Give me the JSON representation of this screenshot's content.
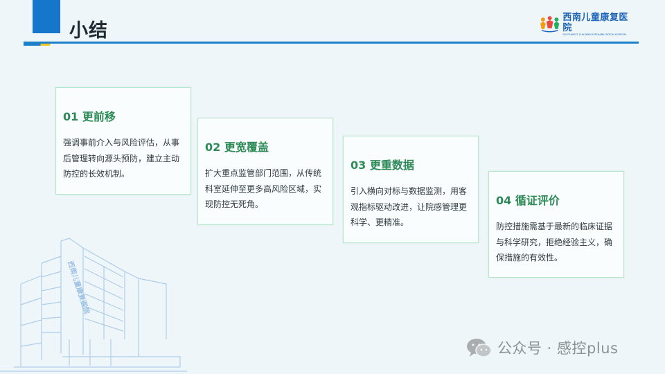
{
  "page": {
    "title": "小结"
  },
  "logo": {
    "name": "西南儿童康复医院",
    "subtitle": "SOUTHWEST CHILDREN'S REHABILITATION HOSPITAL"
  },
  "cards": [
    {
      "heading": "01 更前移",
      "body": "强调事前介入与风险评估，从事后管理转向源头预防，建立主动防控的长效机制。"
    },
    {
      "heading": "02 更宽覆盖",
      "body": "扩大重点监管部门范围，从传统科室延伸至更多高风险区域，实现防控无死角。"
    },
    {
      "heading": "03 更重数据",
      "body": "引入横向对标与数据监测，用客观指标驱动改进，让院感管理更科学、更精准。"
    },
    {
      "heading": "04 循证评价",
      "body": "防控措施需基于最新的临床证据与科学研究，拒绝经验主义，确保措施的有效性。"
    }
  ],
  "building": {
    "sign": "西南儿童康复医院"
  },
  "watermark": {
    "text": "公众号 · 感控plus"
  },
  "colors": {
    "accent_blue": "#1676cc",
    "heading_green": "#2e8b57",
    "card_border": "#b8e6c8",
    "background": "#eef6f9",
    "accent_yellow": "#f3c623"
  }
}
